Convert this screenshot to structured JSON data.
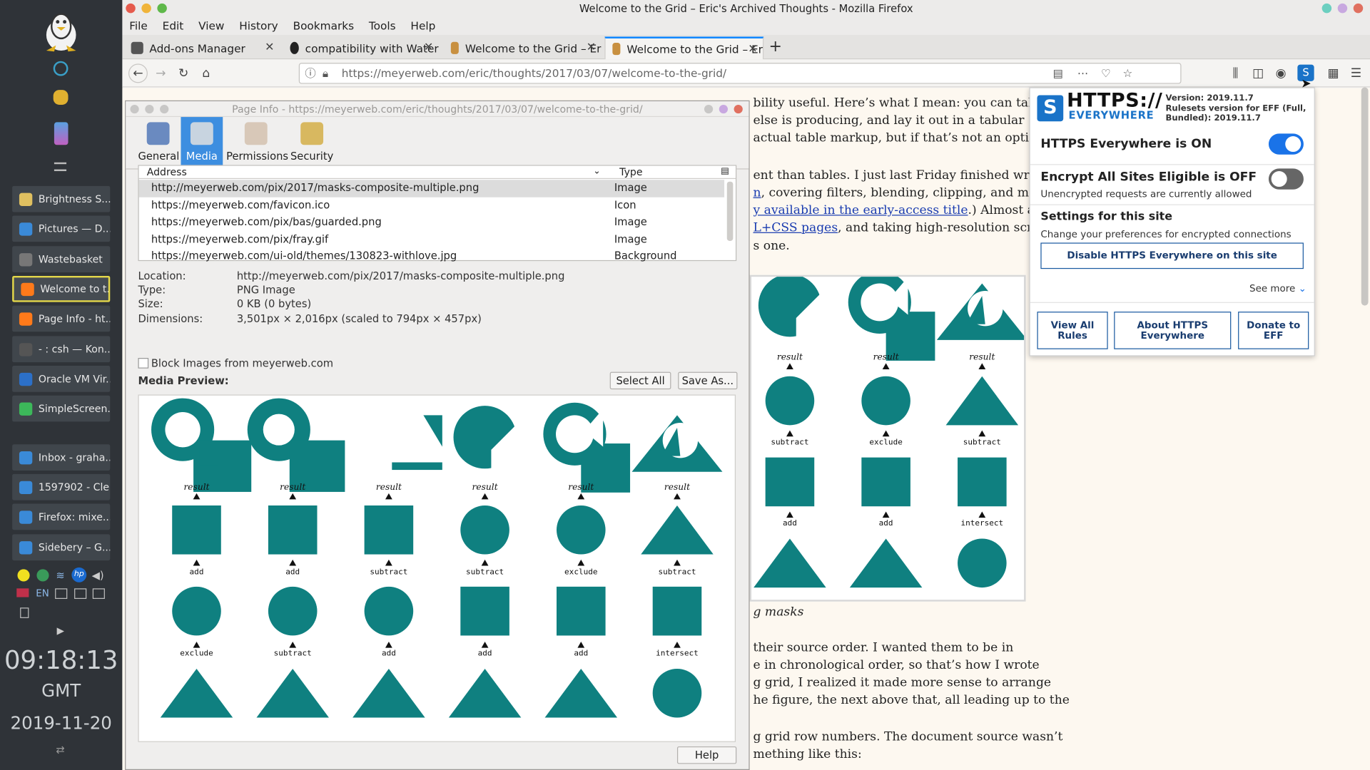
{
  "desktop": {
    "tasks": [
      {
        "label": "Brightness S...",
        "color": "#e0c060"
      },
      {
        "label": "Pictures — D...",
        "color": "#3a8ad8"
      },
      {
        "label": "Wastebasket",
        "color": "#777777"
      },
      {
        "label": "Welcome to t...",
        "color": "#ff7a1a"
      },
      {
        "label": "Page Info - ht...",
        "color": "#ff7a1a"
      },
      {
        "label": "- : csh — Kon...",
        "color": "#555555"
      },
      {
        "label": "Oracle VM Vir...",
        "color": "#2c70c8"
      },
      {
        "label": "SimpleScreen...",
        "color": "#3cb85a"
      },
      {
        "label": "Inbox - graha...",
        "color": "#3a8ad8"
      },
      {
        "label": "1597902 - Cle...",
        "color": "#3a8ad8"
      },
      {
        "label": "Firefox: mixe...",
        "color": "#3a8ad8"
      },
      {
        "label": "Sidebery – G...",
        "color": "#3a8ad8"
      }
    ],
    "tray_lang": "EN",
    "clock": {
      "time": "09:18:13",
      "zone": "GMT",
      "date": "2019-11-20"
    }
  },
  "browser": {
    "window_title": "Welcome to the Grid – Eric's Archived Thoughts - Mozilla Firefox",
    "menu": [
      "File",
      "Edit",
      "View",
      "History",
      "Bookmarks",
      "Tools",
      "Help"
    ],
    "tabs": [
      {
        "label": "Add-ons Manager",
        "selected": false
      },
      {
        "label": "compatibility with Water",
        "selected": false
      },
      {
        "label": "Welcome to the Grid – Er",
        "selected": false
      },
      {
        "label": "Welcome to the Grid – Er",
        "selected": true
      }
    ],
    "url": "https://meyerweb.com/eric/thoughts/2017/03/07/welcome-to-the-grid/",
    "url_domain": "meyerweb.com"
  },
  "article": {
    "lines": [
      "bility useful.  Here’s what I mean: you can take a",
      "else is producing, and lay it out in a tabular",
      "actual table markup, but if that’s not an option,",
      "ent than tables.  I just last Friday finished writing",
      ", covering filters, blending, clipping, and masking.",
      "y available in the early-access title",
      ".)  Almost all",
      "L+CSS pages",
      ", and taking high-resolution screen",
      "s one.",
      "g masks",
      "their source order.  I wanted them to be in",
      "e in chronological order, so that’s how I wrote",
      "g grid, I realized it made more sense to arrange",
      "he figure, the next above that, all leading up to the",
      "g grid row numbers.  The document source wasn’t",
      "mething like this:"
    ]
  },
  "https_everywhere": {
    "brand_top": "HTTPS://",
    "brand_bottom": "EVERYWHERE",
    "version": "Version: 2019.11.7",
    "ruleset": "Rulesets version for EFF (Full,",
    "bundled": "Bundled): 2019.11.7",
    "on_label": "HTTPS Everywhere is ON",
    "on_state": true,
    "encrypt_label": "Encrypt All Sites Eligible is OFF",
    "encrypt_state": false,
    "encrypt_sub": "Unencrypted requests are currently allowed",
    "settings_title": "Settings for this site",
    "settings_sub": "Change your preferences for encrypted connections",
    "disable_button": "Disable HTTPS Everywhere on this site",
    "see_more": "See more",
    "buttons": [
      "View All Rules",
      "About HTTPS Everywhere",
      "Donate to EFF"
    ],
    "accent": "#1a73e8"
  },
  "page_info": {
    "title": "Page Info - https://meyerweb.com/eric/thoughts/2017/03/07/welcome-to-the-grid/",
    "tabs": [
      "General",
      "Media",
      "Permissions",
      "Security"
    ],
    "selected_tab": "Media",
    "columns": [
      "Address",
      "Type"
    ],
    "rows": [
      {
        "address": "http://meyerweb.com/pix/2017/masks-composite-multiple.png",
        "type": "Image"
      },
      {
        "address": "https://meyerweb.com/favicon.ico",
        "type": "Icon"
      },
      {
        "address": "https://meyerweb.com/pix/bas/guarded.png",
        "type": "Image"
      },
      {
        "address": "https://meyerweb.com/pix/fray.gif",
        "type": "Image"
      },
      {
        "address": "https://meyerweb.com/ui-old/themes/130823-withlove.jpg",
        "type": "Background"
      }
    ],
    "details": {
      "location_label": "Location:",
      "location": "http://meyerweb.com/pix/2017/masks-composite-multiple.png",
      "type_label": "Type:",
      "type": "PNG Image",
      "size_label": "Size:",
      "size": "0 KB (0 bytes)",
      "dims_label": "Dimensions:",
      "dims": "3,501px × 2,016px (scaled to 794px × 457px)"
    },
    "block_images": "Block Images from meyerweb.com",
    "media_preview": "Media Preview:",
    "select_all": "Select All",
    "save_as": "Save As...",
    "help": "Help",
    "preview_color": "#0f8080",
    "preview": {
      "result": "result",
      "columns": [
        {
          "op1": "add",
          "op2": "exclude"
        },
        {
          "op1": "add",
          "op2": "subtract"
        },
        {
          "op1": "subtract",
          "op2": "add"
        },
        {
          "op1": "subtract",
          "op2": "add"
        },
        {
          "op1": "exclude",
          "op2": "add"
        },
        {
          "op1": "subtract",
          "op2": "intersect"
        }
      ]
    }
  },
  "figure": {
    "result": "result",
    "columns": [
      {
        "op1": "subtract",
        "op2": "add"
      },
      {
        "op1": "exclude",
        "op2": "add"
      },
      {
        "op1": "subtract",
        "op2": "intersect"
      }
    ]
  }
}
